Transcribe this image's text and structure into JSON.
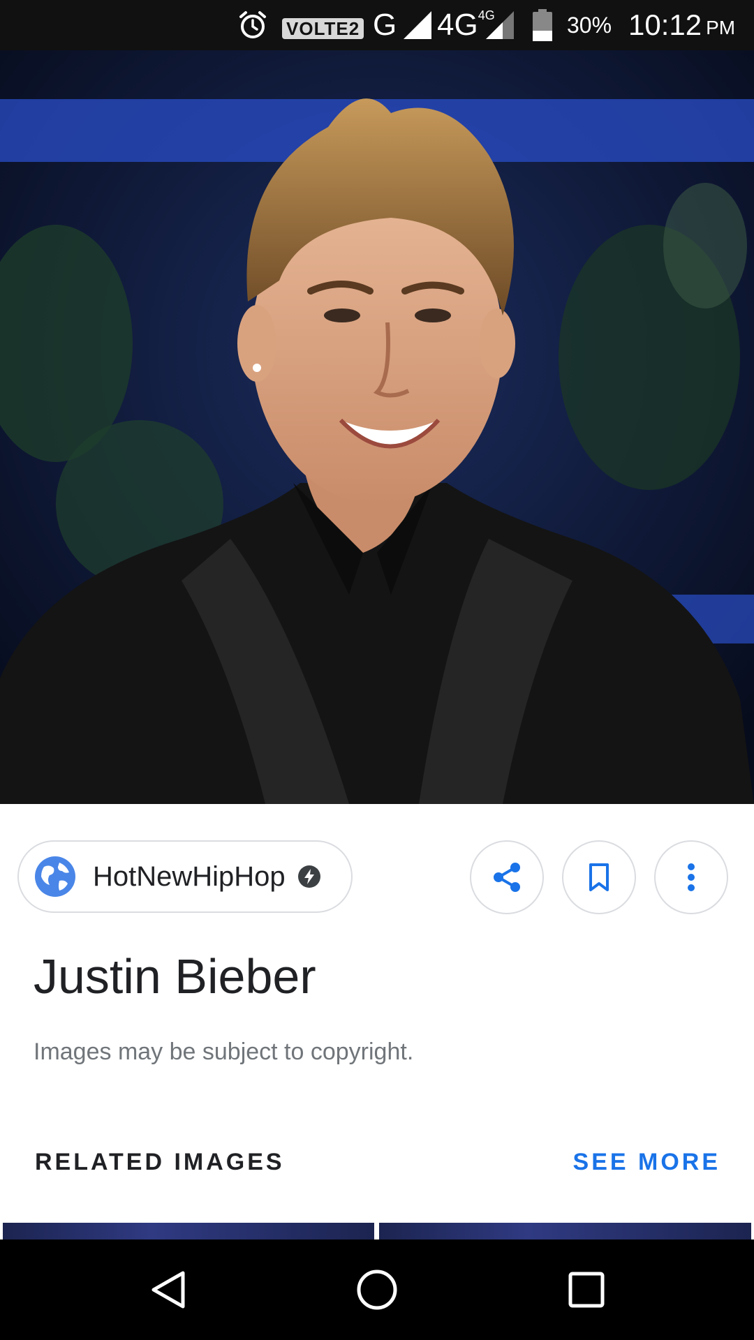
{
  "status_bar": {
    "network_badge": "VOLTE2",
    "network_g": "G",
    "network_4g": "4G",
    "network_4g_small": "4G",
    "battery_percent": "30%",
    "time": "10:12",
    "ampm": "PM",
    "icons": [
      "alarm-icon",
      "signal-icon",
      "signal-icon",
      "battery-icon"
    ]
  },
  "hero_image": {
    "subject": "photo"
  },
  "source": {
    "name": "HotNewHipHop",
    "icon": "globe-icon",
    "badge_icon": "amp-lightning-icon"
  },
  "actions": {
    "icons": [
      "share-icon",
      "bookmark-icon",
      "more-vert-icon"
    ]
  },
  "image_title": "Justin Bieber",
  "copyright_note": "Images may be subject to copyright.",
  "related": {
    "heading": "RELATED IMAGES",
    "see_more": "SEE MORE"
  },
  "nav": {
    "icons": [
      "back-icon",
      "home-icon",
      "recents-icon"
    ]
  },
  "colors": {
    "accent": "#1a73e8",
    "text_primary": "#202124",
    "text_secondary": "#70757a",
    "status_bar": "#111111",
    "nav_bar": "#000000"
  }
}
